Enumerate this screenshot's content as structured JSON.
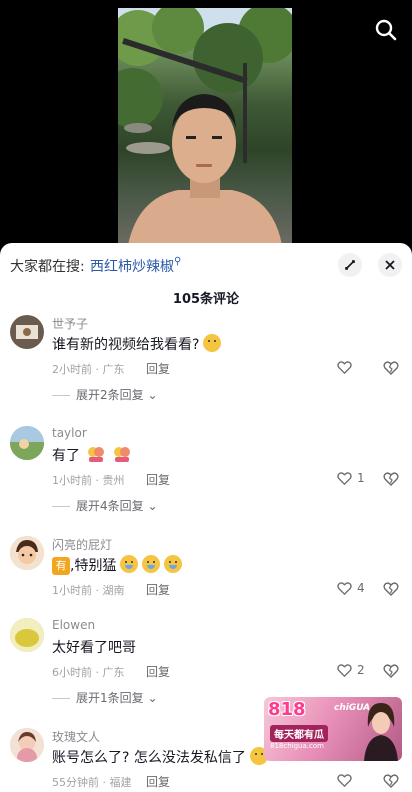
{
  "video": {
    "search_icon": "search-icon"
  },
  "sheet": {
    "search_prefix": "大家都在搜:",
    "search_term": "西红柿炒辣椒",
    "comment_count": "105条评论"
  },
  "comments": [
    {
      "username": "世予子",
      "text": "谁有新的视频给我看看?",
      "time_location": "2小时前 · 广东",
      "reply_label": "回复",
      "likes": "",
      "expand_label": "展开2条回复",
      "avatar_color": "#6b5a4e"
    },
    {
      "username": "taylor",
      "text": "有了",
      "time_location": "1小时前 · 贵州",
      "reply_label": "回复",
      "likes": "1",
      "expand_label": "展开4条回复",
      "avatar_color": "#8cb26c"
    },
    {
      "username": "闪亮的屁灯",
      "badge": "有",
      "text": ",特别猛",
      "time_location": "1小时前 · 湖南",
      "reply_label": "回复",
      "likes": "4",
      "avatar_color": "#e8b894"
    },
    {
      "username": "Elowen",
      "text": "太好看了吧哥",
      "time_location": "6小时前 · 广东",
      "reply_label": "回复",
      "likes": "2",
      "expand_label": "展开1条回复",
      "avatar_color": "#d9c83c"
    },
    {
      "username": "玫瑰文人",
      "text": "账号怎么了? 怎么没法发私信了",
      "time_location": "55分钟前 · 福建",
      "reply_label": "回复",
      "likes": "",
      "avatar_color": "#e7c7b6"
    }
  ],
  "ad": {
    "brand": "818",
    "sub": "chiGUA",
    "slogan": "每天都有瓜",
    "url": "818chigua.com"
  },
  "colors": {
    "link": "#2a5aa8",
    "muted": "#8a8b91",
    "text": "#161823"
  }
}
